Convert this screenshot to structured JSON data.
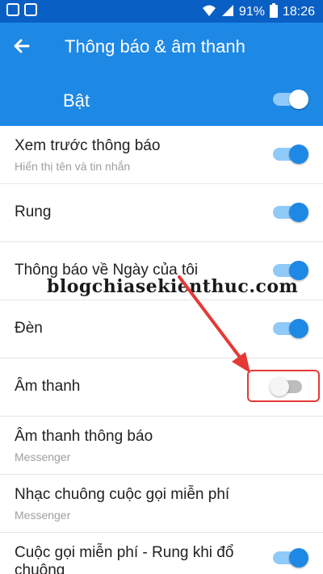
{
  "status_bar": {
    "battery": "91%",
    "time": "18:26"
  },
  "header": {
    "title": "Thông báo & âm thanh",
    "back_icon": "arrow-left-icon"
  },
  "master": {
    "label": "Bật",
    "enabled": true
  },
  "settings": [
    {
      "title": "Xem trước thông báo",
      "subtitle": "Hiển thị tên và tin nhắn",
      "toggle": "on"
    },
    {
      "title": "Rung",
      "subtitle": "",
      "toggle": "on"
    },
    {
      "title": "Thông báo về Ngày của tôi",
      "subtitle": "",
      "toggle": "on"
    },
    {
      "title": "Đèn",
      "subtitle": "",
      "toggle": "on"
    },
    {
      "title": "Âm thanh",
      "subtitle": "",
      "toggle": "off"
    },
    {
      "title": "Âm thanh thông báo",
      "subtitle": "Messenger",
      "toggle": ""
    },
    {
      "title": "Nhạc chuông cuộc gọi miễn phí",
      "subtitle": "Messenger",
      "toggle": ""
    },
    {
      "title": "Cuộc gọi miễn phí - Rung khi đổ chuông",
      "subtitle": "",
      "toggle": "on"
    }
  ],
  "watermark": "blogchiasekienthuc.com",
  "colors": {
    "status_bar": "#0a5fc4",
    "app_bar": "#1e88e5",
    "toggle_on": "#1e88e5",
    "toggle_track_on": "#90caf9",
    "annotation": "#e53935"
  }
}
